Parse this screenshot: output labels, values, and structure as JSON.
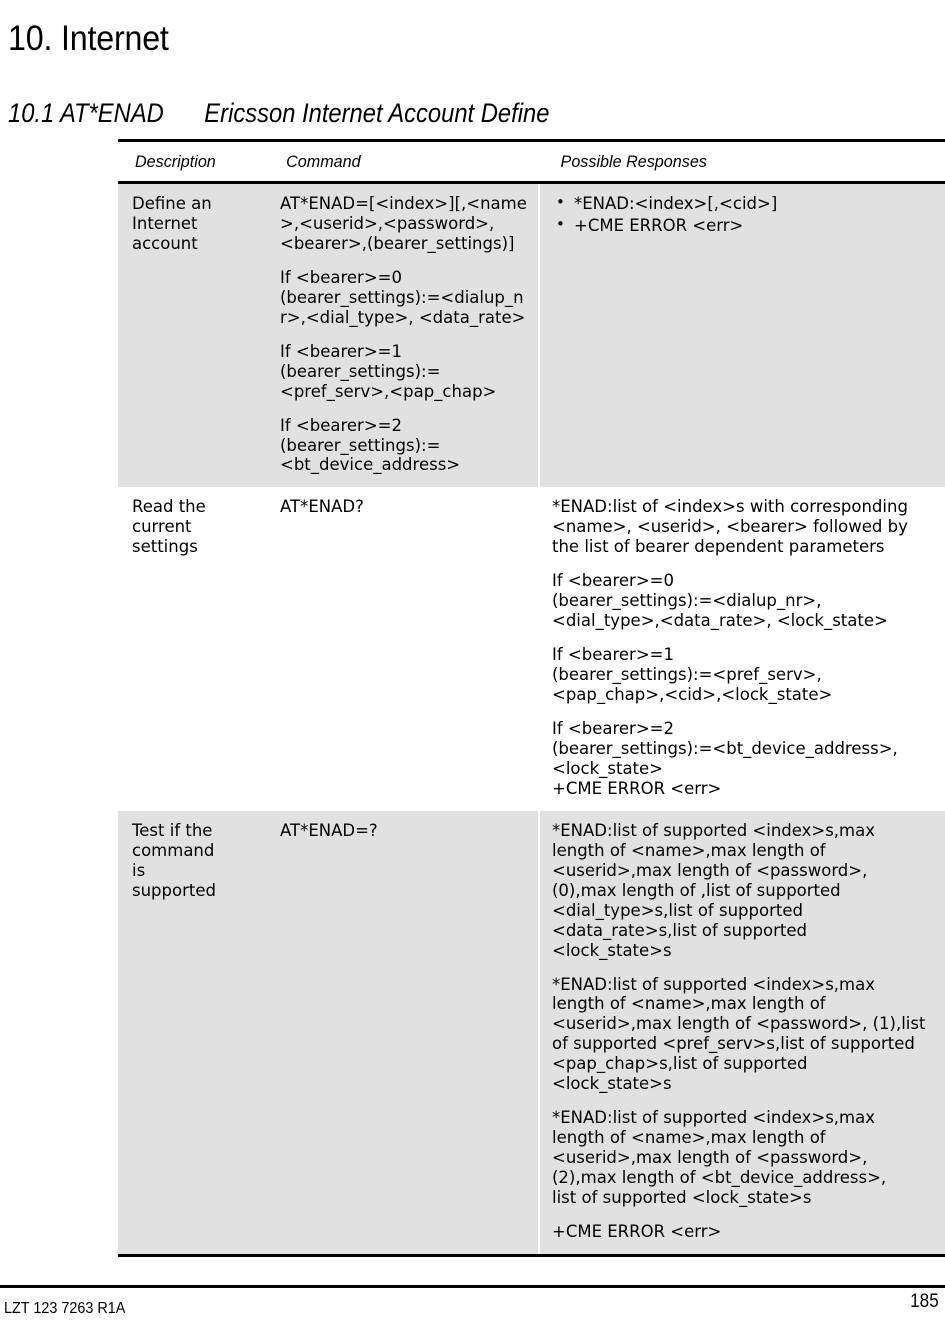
{
  "document": {
    "chapter_title": "10. Internet",
    "section_number": "10.1 AT*ENAD",
    "section_name": "Ericsson Internet Account Define"
  },
  "table": {
    "headers": {
      "description": "Description",
      "command": "Command",
      "responses": "Possible Responses"
    },
    "rows": [
      {
        "description": "Define an\nInternet\naccount",
        "command_paragraphs": [
          "AT*ENAD=[<index>][,<name\n>,<userid>,<password>,\n<bearer>,(bearer_settings)]",
          "If <bearer>=0\n(bearer_settings):=<dialup_n\nr>,<dial_type>, <data_rate>",
          "If <bearer>=1\n(bearer_settings):=\n<pref_serv>,<pap_chap>",
          "If <bearer>=2\n(bearer_settings):=\n<bt_device_address>"
        ],
        "response_bullets": [
          "*ENAD:<index>[,<cid>]",
          "+CME ERROR <err>"
        ],
        "response_paragraphs": [],
        "shaded": true
      },
      {
        "description": "Read the\ncurrent\nsettings",
        "command_paragraphs": [
          "AT*ENAD?"
        ],
        "response_bullets": [],
        "response_paragraphs": [
          "*ENAD:list of <index>s with corresponding\n<name>, <userid>, <bearer> followed by\nthe list of bearer dependent parameters",
          "If <bearer>=0\n(bearer_settings):=<dialup_nr>,\n<dial_type>,<data_rate>, <lock_state>",
          "If <bearer>=1\n(bearer_settings):=<pref_serv>,\n<pap_chap>,<cid>,<lock_state>",
          "If <bearer>=2\n(bearer_settings):=<bt_device_address>,\n<lock_state>\n+CME ERROR <err>"
        ],
        "shaded": false
      },
      {
        "description": "Test if the\ncommand\nis\nsupported",
        "command_paragraphs": [
          "AT*ENAD=?"
        ],
        "response_bullets": [],
        "response_paragraphs": [
          "*ENAD:list of supported <index>s,max\nlength of <name>,max length of\n<userid>,max length of <password>,\n(0),max length of ,list of supported\n<dial_type>s,list of supported\n<data_rate>s,list of supported\n<lock_state>s",
          "*ENAD:list of supported <index>s,max\nlength of <name>,max length of\n<userid>,max length of <password>, (1),list\nof supported <pref_serv>s,list of supported\n<pap_chap>s,list of supported\n<lock_state>s",
          "*ENAD:list of supported <index>s,max\nlength of <name>,max length of\n<userid>,max length of <password>,\n(2),max length of <bt_device_address>,\nlist of supported <lock_state>s",
          "+CME ERROR <err>"
        ],
        "shaded": true
      }
    ]
  },
  "footer": {
    "document_id": "LZT 123 7263 R1A",
    "page_number": "185"
  }
}
